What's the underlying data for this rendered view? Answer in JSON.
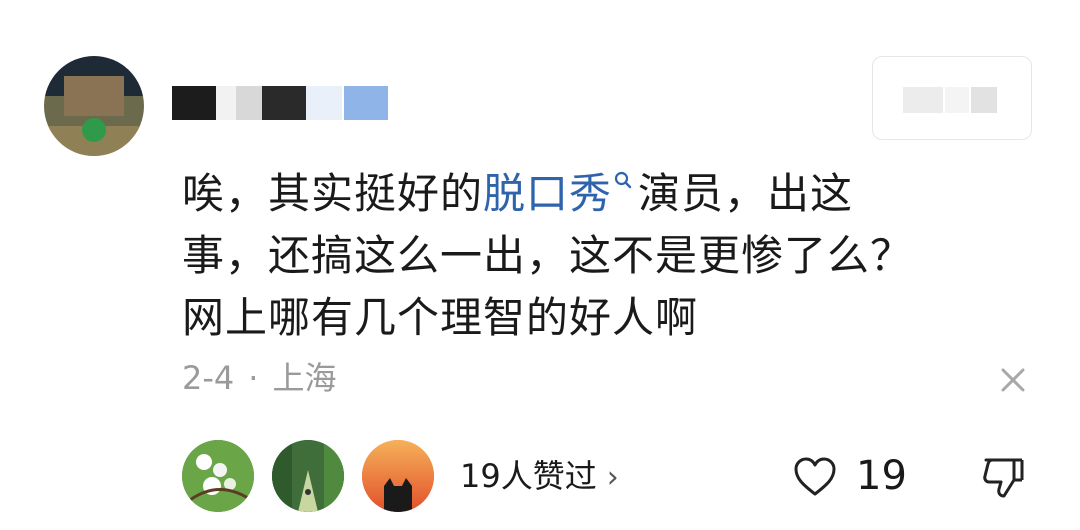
{
  "comment": {
    "part1": "唉，其实挺好的",
    "link_text": "脱口秀",
    "part2": "演员，出这",
    "line2": "事，还搞这么一出，这不是更惨了么？",
    "line3": "网上哪有几个理智的好人啊"
  },
  "meta": {
    "date": "2-4",
    "separator": "·",
    "location": "上海"
  },
  "likes": {
    "summary": "19人赞过",
    "chevron": "›",
    "count": "19"
  },
  "icons": {
    "search_hint": "search-icon",
    "close": "close-icon",
    "heart": "heart-icon",
    "dislike": "thumbs-down-icon",
    "chevron": "chevron-right-icon"
  },
  "colors": {
    "link": "#2f64ad",
    "meta_text": "#9a9a9a",
    "text": "#1a1a1a"
  }
}
